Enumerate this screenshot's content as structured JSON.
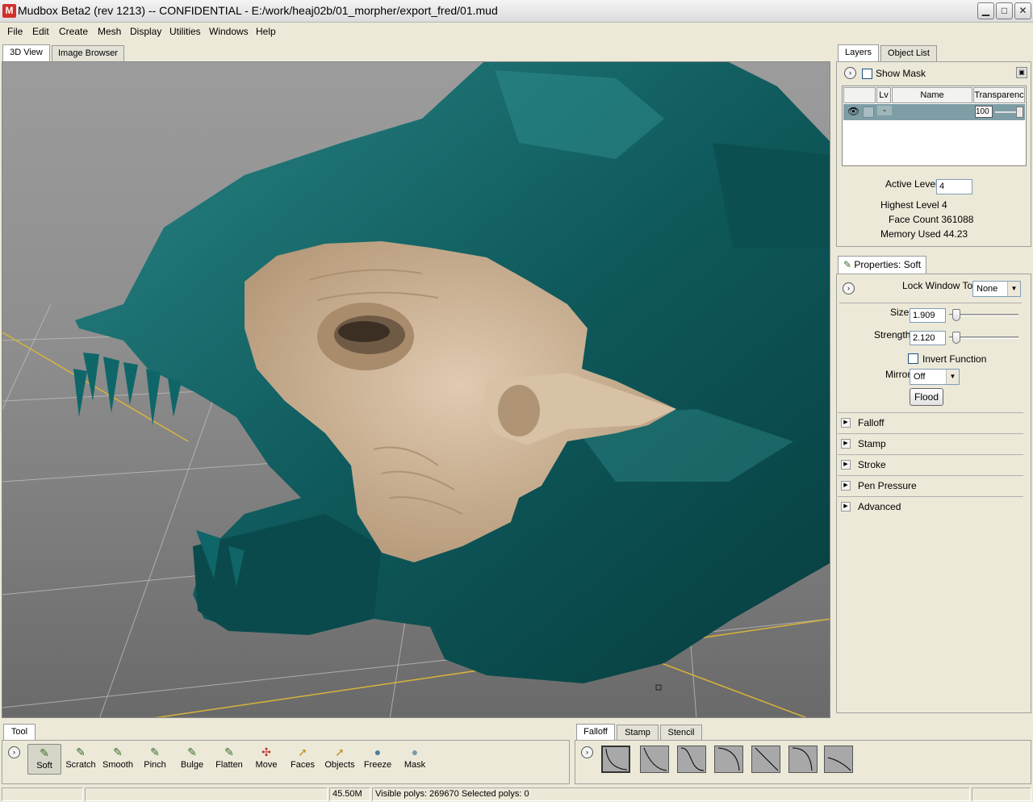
{
  "window": {
    "title": "Mudbox Beta2 (rev 1213) -- CONFIDENTIAL  - E:/work/heaj02b/01_morpher/export_fred/01.mud",
    "app_icon": "M"
  },
  "menu": [
    "File",
    "Edit",
    "Create",
    "Mesh",
    "Display",
    "Utilities",
    "Windows",
    "Help"
  ],
  "view_tabs": [
    "3D View",
    "Image Browser"
  ],
  "right_tabs": [
    "Layers",
    "Object List"
  ],
  "layers": {
    "show_mask_label": "Show Mask",
    "columns": [
      "Lv",
      "Name",
      "Transparenc"
    ],
    "row_level": "-",
    "row_transparency": "100",
    "active_level_label": "Active Level",
    "active_level_value": "4",
    "highest_level": "Highest Level 4",
    "face_count": "Face Count  361088",
    "memory_used": "Memory Used 44.23"
  },
  "properties": {
    "tab_label": "Properties: Soft",
    "lock_window_label": "Lock Window To:",
    "lock_window_value": "None",
    "size_label": "Size",
    "size_value": "1.909",
    "size_level": 0.05,
    "strength_label": "Strength",
    "strength_value": "2.120",
    "strength_level": 0.05,
    "invert_label": "Invert Function",
    "mirror_label": "Mirror",
    "mirror_value": "Off",
    "flood_label": "Flood",
    "sections": [
      "Falloff",
      "Stamp",
      "Stroke",
      "Pen Pressure",
      "Advanced"
    ]
  },
  "tool_shelf": {
    "tab": "Tool",
    "tools": [
      "Soft",
      "Scratch",
      "Smooth",
      "Pinch",
      "Bulge",
      "Flatten",
      "Move",
      "Faces",
      "Objects",
      "Freeze",
      "Mask"
    ]
  },
  "falloff_shelf": {
    "tabs": [
      "Falloff",
      "Stamp",
      "Stencil"
    ]
  },
  "status": {
    "memory": "45.50M",
    "polys": "Visible polys: 269670  Selected polys: 0"
  },
  "colors": {
    "mesh": "#0f5a5c",
    "mesh_highlight": "#2e8a8a",
    "sculpt": "#cfb69a",
    "grid": "#b9b9b9",
    "axis": "#d9b43a"
  }
}
